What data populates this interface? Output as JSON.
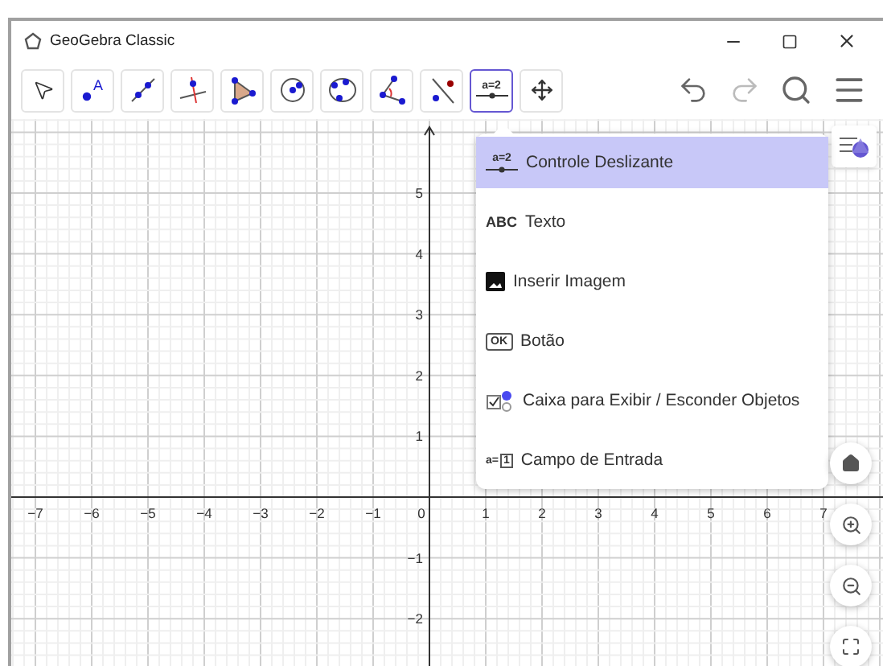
{
  "window": {
    "title": "GeoGebra Classic"
  },
  "toolbar": {
    "tools": [
      {
        "selected": false
      },
      {
        "selected": false,
        "label": "A"
      },
      {
        "selected": false
      },
      {
        "selected": false
      },
      {
        "selected": false
      },
      {
        "selected": false
      },
      {
        "selected": false
      },
      {
        "selected": false
      },
      {
        "selected": false
      },
      {
        "selected": true,
        "label": "a=2"
      },
      {
        "selected": false
      }
    ]
  },
  "menu": {
    "items": [
      {
        "kind": "slider",
        "icon_text": "a=2",
        "label": "Controle Deslizante",
        "selected": true
      },
      {
        "kind": "text",
        "icon_text": "ABC",
        "label": "Texto",
        "selected": false
      },
      {
        "kind": "image",
        "label": "Inserir Imagem",
        "selected": false
      },
      {
        "kind": "button",
        "icon_text": "OK",
        "label": "Botão",
        "selected": false
      },
      {
        "kind": "checkbox",
        "label": "Caixa para Exibir / Esconder Objetos",
        "selected": false
      },
      {
        "kind": "input",
        "icon_text": "a=",
        "icon_box_text": "1",
        "label": "Campo de Entrada",
        "selected": false
      }
    ]
  },
  "graphics": {
    "x_labels": [
      "−7",
      "−6",
      "−5",
      "−4",
      "−3",
      "−2",
      "−1",
      "0",
      "1",
      "2",
      "3",
      "4",
      "5",
      "6",
      "7"
    ],
    "y_labels": [
      "5",
      "4",
      "3",
      "2",
      "1",
      "−1",
      "−2"
    ]
  }
}
